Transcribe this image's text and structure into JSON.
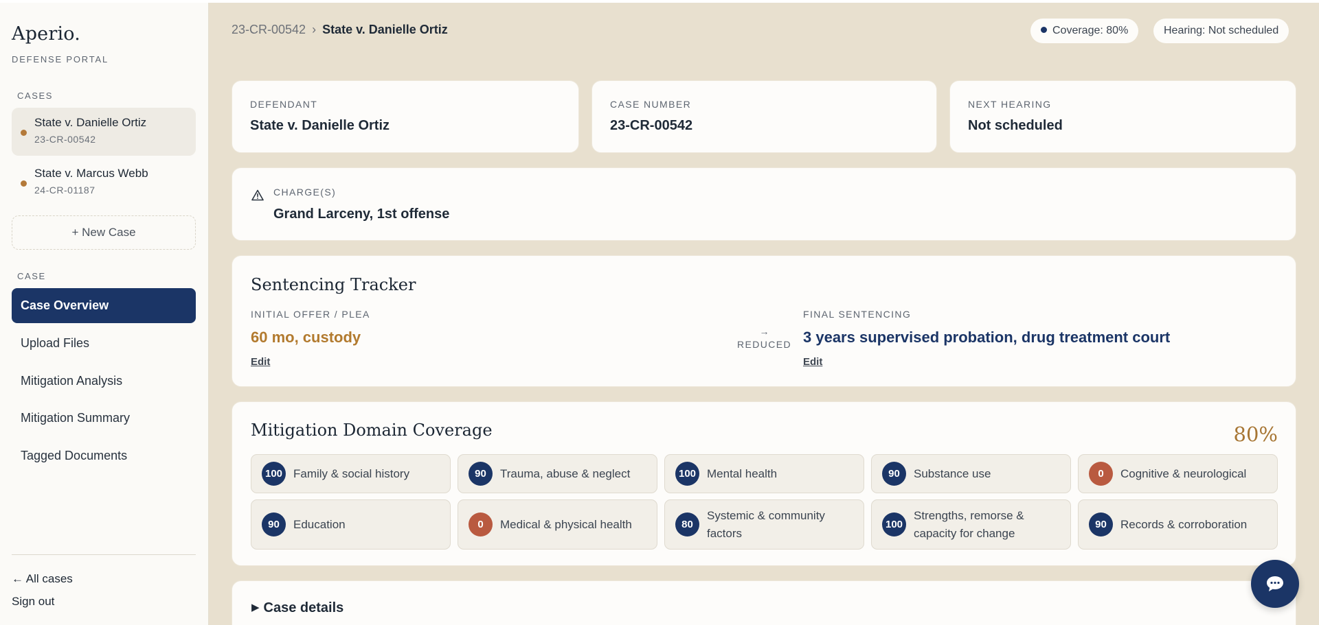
{
  "sidebar": {
    "brand": "Aperio.",
    "brand_sub": "DEFENSE PORTAL",
    "cases_label": "CASES",
    "cases": [
      {
        "title": "State v. Danielle Ortiz",
        "number": "23-CR-00542",
        "active": true
      },
      {
        "title": "State v. Marcus Webb",
        "number": "24-CR-01187",
        "active": false
      }
    ],
    "new_case": "+ New Case",
    "case_label": "CASE",
    "nav": [
      {
        "label": "Case Overview",
        "active": true
      },
      {
        "label": "Upload Files",
        "active": false
      },
      {
        "label": "Mitigation Analysis",
        "active": false
      },
      {
        "label": "Mitigation Summary",
        "active": false
      },
      {
        "label": "Tagged Documents",
        "active": false
      }
    ],
    "all_cases": "← All cases",
    "sign_out": "Sign out"
  },
  "header": {
    "breadcrumb_case_number": "23-CR-00542",
    "breadcrumb_sep": "›",
    "breadcrumb_current": "State v. Danielle Ortiz",
    "coverage_pill": "Coverage: 80%",
    "hearing_pill": "Hearing: Not scheduled"
  },
  "info_cards": {
    "defendant_label": "DEFENDANT",
    "defendant_value": "State v. Danielle Ortiz",
    "case_number_label": "CASE NUMBER",
    "case_number_value": "23-CR-00542",
    "next_hearing_label": "NEXT HEARING",
    "next_hearing_value": "Not scheduled"
  },
  "charges": {
    "label": "CHARGE(S)",
    "value": "Grand Larceny, 1st offense"
  },
  "tracker": {
    "title": "Sentencing Tracker",
    "initial_label": "INITIAL OFFER / PLEA",
    "initial_value": "60 mo, custody",
    "edit": "Edit",
    "arrow": "→",
    "reduced": "REDUCED",
    "final_label": "FINAL SENTENCING",
    "final_value": "3 years supervised probation, drug treatment court"
  },
  "coverage": {
    "title": "Mitigation Domain Coverage",
    "percent": "80%",
    "domains": [
      {
        "score": "100",
        "label": "Family & social history"
      },
      {
        "score": "90",
        "label": "Trauma, abuse & neglect"
      },
      {
        "score": "100",
        "label": "Mental health"
      },
      {
        "score": "90",
        "label": "Substance use"
      },
      {
        "score": "0",
        "label": "Cognitive & neurological"
      },
      {
        "score": "90",
        "label": "Education"
      },
      {
        "score": "0",
        "label": "Medical & physical health"
      },
      {
        "score": "80",
        "label": "Systemic & community factors"
      },
      {
        "score": "100",
        "label": "Strengths, remorse & capacity for change"
      },
      {
        "score": "90",
        "label": "Records & corroboration"
      }
    ]
  },
  "details": {
    "title": "Case details",
    "toggle": "▶"
  },
  "colors": {
    "navy": "#1b3566",
    "amber": "#b27a2e",
    "zero_badge": "#b95a40",
    "page_bg": "#e8e0cf"
  }
}
